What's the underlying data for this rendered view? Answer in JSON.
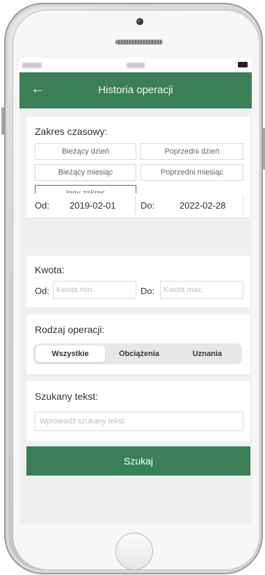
{
  "status_bar": {
    "battery_icon": "battery-icon"
  },
  "app_bar": {
    "back_icon": "arrow-left-icon",
    "title": "Historia operacji"
  },
  "date_range": {
    "label": "Zakres czasowy:",
    "buttons": [
      {
        "label": "Bieżący dzień"
      },
      {
        "label": "Poprzedni dzień"
      },
      {
        "label": "Bieżący miesiąc"
      },
      {
        "label": "Poprzedni miesiąc"
      },
      {
        "label": "Inny zakres",
        "selected": true
      }
    ],
    "from_label": "Od:",
    "from_value": "2019-02-01",
    "to_label": "Do:",
    "to_value": "2022-02-28"
  },
  "amount": {
    "label": "Kwota:",
    "from_label": "Od:",
    "from_placeholder": "Kwota min.",
    "to_label": "Do:",
    "to_placeholder": "Kwota max."
  },
  "operation_type": {
    "label": "Rodzaj operacji:",
    "options": [
      {
        "label": "Wszystkie",
        "selected": true
      },
      {
        "label": "Obciążenia",
        "selected": false
      },
      {
        "label": "Uznania",
        "selected": false
      }
    ]
  },
  "search_text": {
    "label": "Szukany tekst:",
    "placeholder": "Wprowadź szukany tekst"
  },
  "search_button": {
    "label": "Szukaj"
  },
  "colors": {
    "accent": "#3b7f58",
    "screen_background": "#efefef"
  }
}
